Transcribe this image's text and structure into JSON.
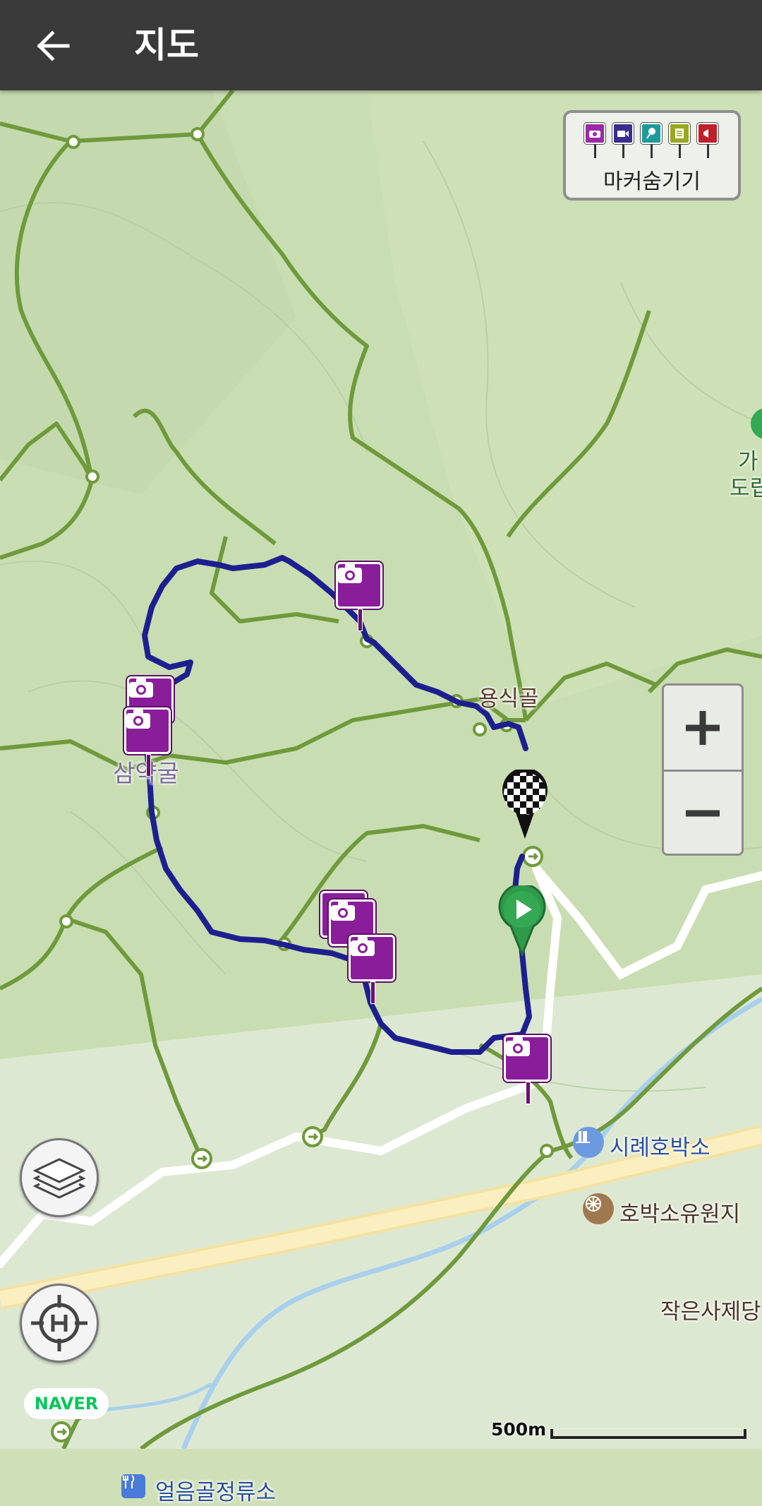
{
  "appbar": {
    "title": "지도",
    "back_icon": "arrow-left-icon"
  },
  "marker_toggle": {
    "label": "마커숨기기",
    "icons": [
      {
        "name": "photo-marker-icon",
        "color": "#9b2aa8"
      },
      {
        "name": "video-marker-icon",
        "color": "#3b2d8f"
      },
      {
        "name": "audio-marker-icon",
        "color": "#1f9a9a"
      },
      {
        "name": "memo-marker-icon",
        "color": "#9aa81f"
      },
      {
        "name": "announcement-marker-icon",
        "color": "#c0202a"
      }
    ]
  },
  "zoom": {
    "zoom_in_icon": "plus-icon",
    "zoom_out_icon": "minus-icon"
  },
  "map": {
    "labels": {
      "yongsikgol": "용식골",
      "samyakgul": "삼약굴",
      "sirye_hobakso": "시례호박소",
      "hobakso_park": "호박소유원지",
      "jageun_saje": "작은사제당",
      "eoleumgol_stop": "얼음골정류소",
      "partial_top_1": "가",
      "partial_top_2": "도립"
    },
    "track_color": "#1e1f8f",
    "trail_color": "#6f9a3c",
    "photo_marker_color": "#8a1e9a",
    "start_marker_color": "#2e9a4a"
  },
  "attribution": "NAVER",
  "scale": {
    "label": "500m"
  },
  "buttons": {
    "layers_icon": "layers-icon",
    "locate_icon": "crosshair-h-icon"
  }
}
